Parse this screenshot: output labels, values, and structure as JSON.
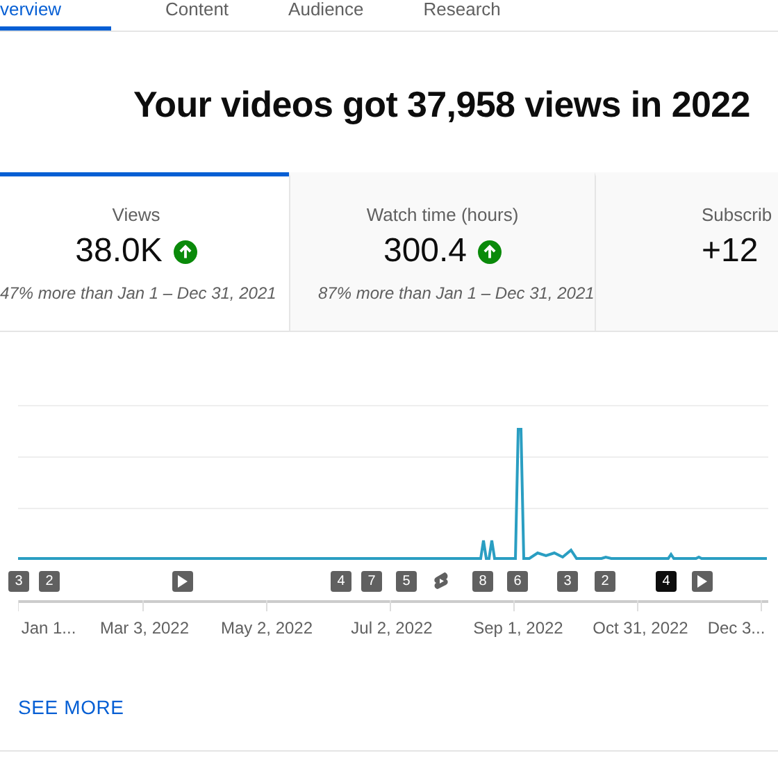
{
  "tabs": [
    {
      "label": "verview",
      "selected": true
    },
    {
      "label": "Content",
      "selected": false
    },
    {
      "label": "Audience",
      "selected": false
    },
    {
      "label": "Research",
      "selected": false
    }
  ],
  "headline": "Your videos got 37,958 views in 2022",
  "metrics": [
    {
      "label": "Views",
      "value": "38.0K",
      "rising": true,
      "comparison": "47% more than Jan 1 – Dec 31, 2021",
      "selected": true
    },
    {
      "label": "Watch time (hours)",
      "value": "300.4",
      "rising": true,
      "comparison": "87% more than Jan 1 – Dec 31, 2021",
      "selected": false
    },
    {
      "label": "Subscrib",
      "value": "+12",
      "rising": false,
      "selected": false
    }
  ],
  "markers": [
    {
      "kind": "count",
      "label": "3",
      "selected": false
    },
    {
      "kind": "count",
      "label": "2",
      "selected": false
    },
    {
      "kind": "video",
      "selected": false
    },
    {
      "kind": "count",
      "label": "4",
      "selected": false
    },
    {
      "kind": "count",
      "label": "7",
      "selected": false
    },
    {
      "kind": "count",
      "label": "5",
      "selected": false
    },
    {
      "kind": "short",
      "selected": false
    },
    {
      "kind": "count",
      "label": "8",
      "selected": false
    },
    {
      "kind": "count",
      "label": "6",
      "selected": false
    },
    {
      "kind": "count",
      "label": "3",
      "selected": false
    },
    {
      "kind": "count",
      "label": "2",
      "selected": false
    },
    {
      "kind": "count",
      "label": "4",
      "selected": true
    },
    {
      "kind": "video",
      "selected": false
    }
  ],
  "x_labels": [
    "Jan 1...",
    "Mar 3, 2022",
    "May 2, 2022",
    "Jul 2, 2022",
    "Sep 1, 2022",
    "Oct 31, 2022",
    "Dec 3..."
  ],
  "see_more": "SEE MORE"
}
